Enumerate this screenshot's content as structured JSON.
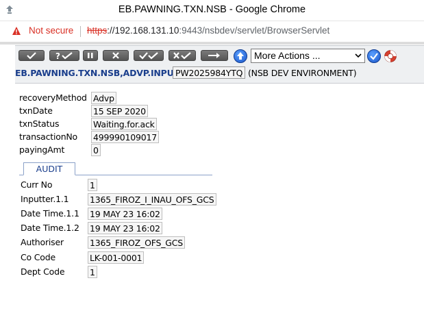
{
  "window": {
    "title": "EB.PAWNING.TXN.NSB - Google Chrome"
  },
  "address_bar": {
    "security_label": "Not secure",
    "url_scheme": "https",
    "url_host": "://192.168.131.10",
    "url_rest": ":9443/nsbdev/servlet/BrowserServlet"
  },
  "toolbar": {
    "buttons": [
      {
        "name": "commit",
        "icon": "check-icon"
      },
      {
        "name": "validate",
        "icon": "question-check-icon"
      },
      {
        "name": "hold",
        "icon": "pause-icon"
      },
      {
        "name": "delete",
        "icon": "x-icon"
      },
      {
        "name": "authorise",
        "icon": "double-check-icon"
      },
      {
        "name": "reverse",
        "icon": "x-check-icon"
      },
      {
        "name": "next",
        "icon": "arrow-right-icon"
      }
    ],
    "more_actions_label": "More Actions ...",
    "version_label": "EB.PAWNING.TXN.NSB,ADVP.INPUT",
    "transaction_id": "PW2025984YTQ",
    "environment_label": "(NSB DEV ENVIRONMENT)"
  },
  "fields": [
    {
      "label": "recoveryMethod",
      "value": "Advp"
    },
    {
      "label": "txnDate",
      "value": "15 SEP 2020"
    },
    {
      "label": "txnStatus",
      "value": "Waiting.for.ack"
    },
    {
      "label": "transactionNo",
      "value": "499990109017"
    },
    {
      "label": "payingAmt",
      "value": "0"
    }
  ],
  "audit": {
    "tab_label": "AUDIT",
    "fields": [
      {
        "label": "Curr No",
        "value": "1"
      },
      {
        "label": "Inputter.1.1",
        "value": "1365_FIROZ_I_INAU_OFS_GCS"
      },
      {
        "label": "Date Time.1.1",
        "value": "19 MAY 23 16:02"
      },
      {
        "label": "Date Time.1.2",
        "value": "19 MAY 23 16:02"
      },
      {
        "label": "Authoriser",
        "value": "1365_FIROZ_OFS_GCS"
      },
      {
        "label": "Co Code",
        "value": "LK-001-0001"
      },
      {
        "label": "Dept Code",
        "value": "1"
      }
    ]
  },
  "colors": {
    "accent": "#1a3e8c",
    "warning": "#d93025",
    "button": "#666666"
  }
}
